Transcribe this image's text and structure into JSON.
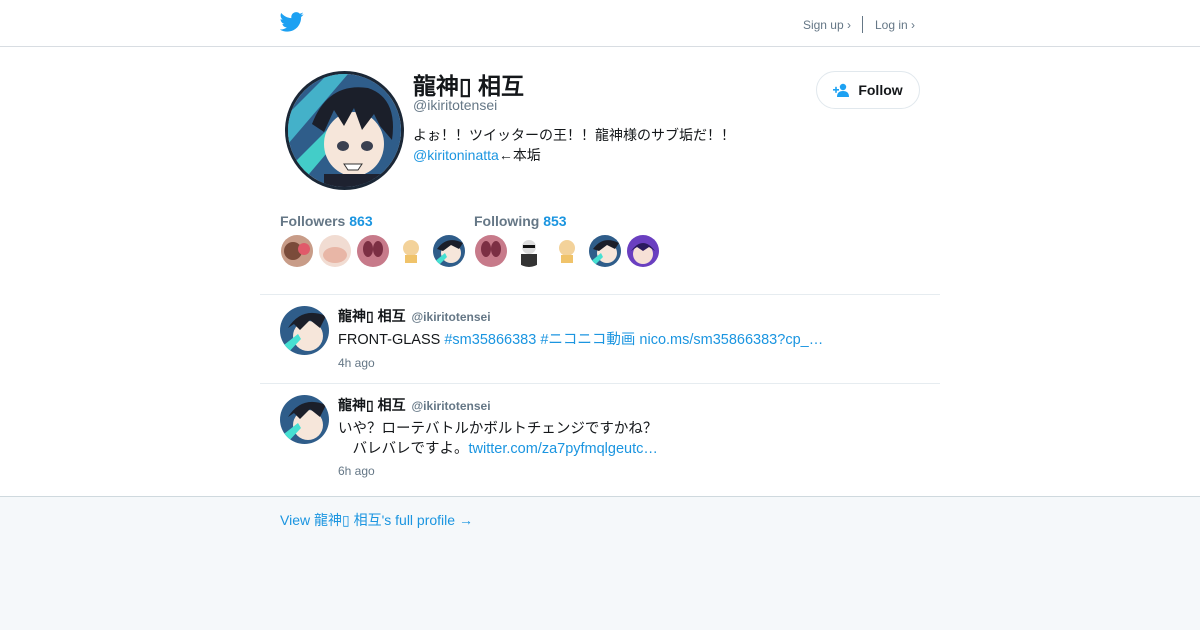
{
  "header": {
    "logo_icon": "twitter-bird-icon",
    "signup_label": "Sign up ›",
    "login_label": "Log in ›"
  },
  "profile": {
    "name": "龍神▯ 相互",
    "handle": "@ikiritotensei",
    "bio_line1": "よぉ！！ツイッターの王！！龍神様のサブ垢だ！！",
    "bio_mention": "@kiritoninatta",
    "bio_line2_rest": "←本垢",
    "follow_label": "Follow"
  },
  "stats": {
    "followers_label": "Followers",
    "followers_count": "863",
    "following_label": "Following",
    "following_count": "853"
  },
  "tweets": [
    {
      "name": "龍神▯ 相互",
      "handle": "@ikiritotensei",
      "text": "FRONT-GLASS ",
      "links": [
        "#sm35866383",
        "#ニコニコ動画",
        "nico.ms/sm35866383?cp_…"
      ],
      "time": "4h ago"
    },
    {
      "name": "龍神▯ 相互",
      "handle": "@ikiritotensei",
      "line1": "いや？ローテバトルかボルトチェンジですかね？",
      "line2": "　バレバレですよ。",
      "link": "twitter.com/za7pyfmqlgeutc…",
      "time": "6h ago"
    }
  ],
  "footer": {
    "full_profile_label": "View 龍神▯ 相互's full profile →"
  },
  "colors": {
    "link": "#1b95e0",
    "muted": "#657786",
    "page_bg": "#f5f8fa"
  }
}
